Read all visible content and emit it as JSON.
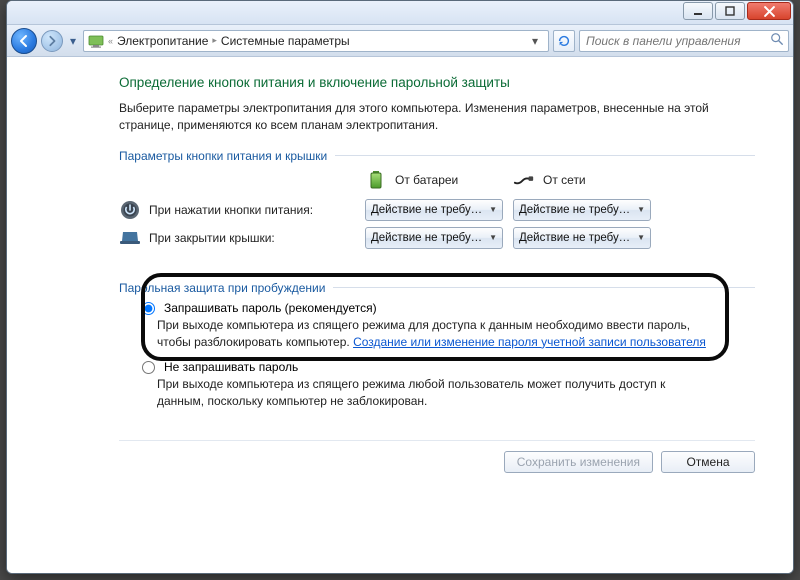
{
  "window": {
    "minimize_tip": "Свернуть",
    "maximize_tip": "Развернуть",
    "close_tip": "Закрыть"
  },
  "breadcrumb": {
    "root_icon": "control-panel",
    "item1": "Электропитание",
    "item2": "Системные параметры"
  },
  "search": {
    "placeholder": "Поиск в панели управления"
  },
  "page": {
    "title": "Определение кнопок питания и включение парольной защиты",
    "intro": "Выберите параметры электропитания для этого компьютера. Изменения параметров, внесенные на этой странице, применяются ко всем планам электропитания."
  },
  "buttons_section": {
    "label": "Параметры кнопки питания и крышки",
    "col_battery": "От батареи",
    "col_ac": "От сети",
    "row_power_button": "При нажатии кнопки питания:",
    "row_lid_close": "При закрытии крышки:",
    "option_noop": "Действие не требуется"
  },
  "password_section": {
    "label": "Парольная защита при пробуждении",
    "require_label": "Запрашивать пароль (рекомендуется)",
    "require_desc_1": "При выходе компьютера из спящего режима для доступа к данным необходимо ввести пароль, чтобы разблокировать компьютер. ",
    "require_link": "Создание или изменение пароля учетной записи пользователя",
    "norequire_label": "Не запрашивать пароль",
    "norequire_desc": "При выходе компьютера из спящего режима любой пользователь может получить доступ к данным, поскольку компьютер не заблокирован."
  },
  "footer": {
    "save": "Сохранить изменения",
    "cancel": "Отмена"
  }
}
